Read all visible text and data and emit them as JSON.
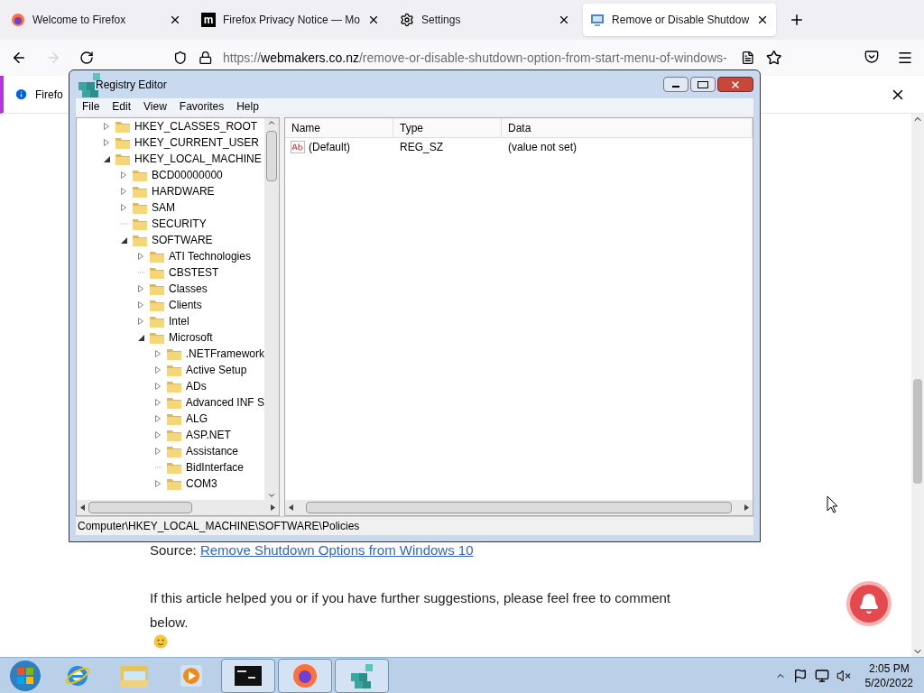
{
  "browser": {
    "tabs": [
      {
        "title": "Welcome to Firefox",
        "kind": "firefox",
        "selected": false
      },
      {
        "title": "Firefox Privacy Notice — Mo",
        "kind": "mozilla",
        "logo": "m",
        "selected": false
      },
      {
        "title": "Settings",
        "kind": "settings",
        "selected": false
      },
      {
        "title": "Remove or Disable Shutdow",
        "kind": "page",
        "selected": true
      }
    ],
    "url": {
      "scheme": "https://",
      "domain": "webmakers.co.nz",
      "path": "/remove-or-disable-shutdown-option-from-start-menu-of-windows-"
    },
    "notification": "Firefo",
    "page": {
      "source_label": "Source:",
      "source_link": "Remove Shutdown Options from Windows 10",
      "paragraph": "If this article helped you or if you have further suggestions, please feel free to comment below."
    }
  },
  "registry": {
    "title": "Registry Editor",
    "menu": [
      "File",
      "Edit",
      "View",
      "Favorites",
      "Help"
    ],
    "tree": [
      {
        "label": "HKEY_CLASSES_ROOT",
        "expandable": true,
        "expanded": false
      },
      {
        "label": "HKEY_CURRENT_USER",
        "expandable": true,
        "expanded": false
      },
      {
        "label": "HKEY_LOCAL_MACHINE",
        "expandable": true,
        "expanded": true,
        "children": [
          {
            "label": "BCD00000000",
            "expandable": true,
            "expanded": false
          },
          {
            "label": "HARDWARE",
            "expandable": true,
            "expanded": false
          },
          {
            "label": "SAM",
            "expandable": true,
            "expanded": false
          },
          {
            "label": "SECURITY",
            "expandable": false,
            "expanded": false
          },
          {
            "label": "SOFTWARE",
            "expandable": true,
            "expanded": true,
            "children": [
              {
                "label": "ATI Technologies",
                "expandable": true,
                "expanded": false
              },
              {
                "label": "CBSTEST",
                "expandable": false,
                "expanded": false
              },
              {
                "label": "Classes",
                "expandable": true,
                "expanded": false
              },
              {
                "label": "Clients",
                "expandable": true,
                "expanded": false
              },
              {
                "label": "Intel",
                "expandable": true,
                "expanded": false
              },
              {
                "label": "Microsoft",
                "expandable": true,
                "expanded": true,
                "children": [
                  {
                    "label": ".NETFramework",
                    "expandable": true,
                    "expanded": false
                  },
                  {
                    "label": "Active Setup",
                    "expandable": true,
                    "expanded": false
                  },
                  {
                    "label": "ADs",
                    "expandable": true,
                    "expanded": false
                  },
                  {
                    "label": "Advanced INF S",
                    "expandable": true,
                    "expanded": false
                  },
                  {
                    "label": "ALG",
                    "expandable": true,
                    "expanded": false
                  },
                  {
                    "label": "ASP.NET",
                    "expandable": true,
                    "expanded": false
                  },
                  {
                    "label": "Assistance",
                    "expandable": true,
                    "expanded": false
                  },
                  {
                    "label": "BidInterface",
                    "expandable": false,
                    "expanded": false
                  },
                  {
                    "label": "COM3",
                    "expandable": true,
                    "expanded": false
                  }
                ]
              }
            ]
          }
        ]
      }
    ],
    "columns": [
      "Name",
      "Type",
      "Data"
    ],
    "values": [
      {
        "name": "(Default)",
        "type": "REG_SZ",
        "data": "(value not set)"
      }
    ],
    "status": "Computer\\HKEY_LOCAL_MACHINE\\SOFTWARE\\Policies"
  },
  "taskbar": {
    "items": [
      {
        "kind": "ie",
        "running": false
      },
      {
        "kind": "explorer",
        "running": false
      },
      {
        "kind": "media",
        "running": false
      },
      {
        "kind": "cmd",
        "running": true
      },
      {
        "kind": "firefox",
        "running": true
      },
      {
        "kind": "regedit",
        "running": true
      }
    ],
    "time": "2:05 PM",
    "date": "5/20/2022"
  }
}
